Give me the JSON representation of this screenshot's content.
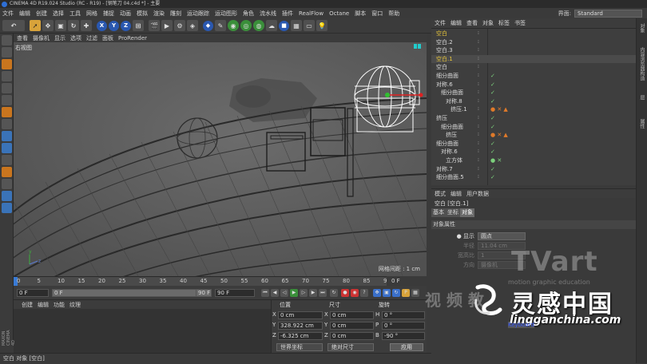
{
  "window": {
    "title": "CINEMA 4D R19.024 Studio (RC - R19) - [钢笔刀 04.c4d *] - 主要"
  },
  "menu": [
    "文件",
    "编辑",
    "创建",
    "选择",
    "工具",
    "网格",
    "捕捉",
    "动画",
    "模拟",
    "渲染",
    "雕刻",
    "运动跟踪",
    "运动图形",
    "角色",
    "流水线",
    "插件",
    "RealFlow",
    "Octane",
    "脚本",
    "窗口",
    "帮助"
  ],
  "layout": {
    "label": "界面:",
    "value": "Standard"
  },
  "toolbar": {
    "undo": "↶",
    "axes": [
      "X",
      "Y",
      "Z"
    ]
  },
  "viewport": {
    "menu": [
      "查看",
      "摄像机",
      "显示",
      "选项",
      "过滤",
      "面板",
      "ProRender"
    ],
    "label": "右视图",
    "grid_spacing": "网格间距 : 1 cm"
  },
  "timeline": {
    "ticks": [
      "0",
      "5",
      "10",
      "15",
      "20",
      "25",
      "30",
      "35",
      "40",
      "45",
      "50",
      "55",
      "60",
      "65",
      "70",
      "75",
      "80",
      "85",
      "90"
    ],
    "frame_display": "0 F",
    "start_field": "0 F",
    "min_field": "0 F",
    "end_min": "90 F",
    "end_max": "90 F"
  },
  "materials": {
    "menu": [
      "创建",
      "编辑",
      "功能",
      "纹理"
    ],
    "logo": "MAXON CINEMA 4D"
  },
  "coordinates": {
    "headers": {
      "position": "位置",
      "size": "尺寸",
      "rotation": "旋转"
    },
    "position": [
      {
        "axis": "X",
        "value": "0 cm"
      },
      {
        "axis": "Y",
        "value": "328.922 cm"
      },
      {
        "axis": "Z",
        "value": "-6.325 cm"
      }
    ],
    "size": [
      {
        "axis": "X",
        "value": "0 cm"
      },
      {
        "axis": "Y",
        "value": "0 cm"
      },
      {
        "axis": "Z",
        "value": "0 cm"
      }
    ],
    "rotation": [
      {
        "axis": "H",
        "value": "0 °"
      },
      {
        "axis": "P",
        "value": "0 °"
      },
      {
        "axis": "B",
        "value": "-90 °"
      }
    ],
    "world_coords": "世界坐标",
    "abs_size": "绝对尺寸",
    "apply": "应用"
  },
  "status": {
    "text": "空白 对象 [空白]"
  },
  "object_manager": {
    "menu": [
      "文件",
      "编辑",
      "查看",
      "对象",
      "标签",
      "书签"
    ],
    "rows": [
      {
        "name": "空白",
        "indent": 0,
        "highlight": true,
        "tags": ""
      },
      {
        "name": "空白.2",
        "indent": 0,
        "highlight": false,
        "tags": ""
      },
      {
        "name": "空白.3",
        "indent": 0,
        "highlight": false,
        "tags": ""
      },
      {
        "name": "空白.1",
        "indent": 0,
        "highlight": true,
        "tags": ""
      },
      {
        "name": "空白",
        "indent": 0,
        "highlight": false,
        "tags": ""
      },
      {
        "name": "细分曲面",
        "indent": 0,
        "highlight": false,
        "tags": "✓"
      },
      {
        "name": "对称.6",
        "indent": 0,
        "highlight": false,
        "tags": "✓"
      },
      {
        "name": "细分曲面",
        "indent": 1,
        "highlight": false,
        "tags": "✓"
      },
      {
        "name": "对称.8",
        "indent": 2,
        "highlight": false,
        "tags": "✓"
      },
      {
        "name": "挤压.1",
        "indent": 3,
        "highlight": false,
        "tags": "● ✕ ▲"
      },
      {
        "name": "挤压",
        "indent": 0,
        "highlight": false,
        "tags": "✓"
      },
      {
        "name": "细分曲面",
        "indent": 1,
        "highlight": false,
        "tags": "✓"
      },
      {
        "name": "挤压",
        "indent": 2,
        "highlight": false,
        "tags": "● ✕ ▲"
      },
      {
        "name": "细分曲面",
        "indent": 0,
        "highlight": false,
        "tags": "✓"
      },
      {
        "name": "对称.6",
        "indent": 1,
        "highlight": false,
        "tags": "✓"
      },
      {
        "name": "立方体",
        "indent": 2,
        "highlight": false,
        "tags": "● ✕"
      },
      {
        "name": "对称.7",
        "indent": 0,
        "highlight": false,
        "tags": "✓"
      },
      {
        "name": "细分曲面.5",
        "indent": 0,
        "highlight": false,
        "tags": "✓"
      }
    ]
  },
  "attributes": {
    "menu": [
      "模式",
      "编辑",
      "用户数据"
    ],
    "title": "空白 [空白.1]",
    "tabs": [
      "基本",
      "坐标",
      "对象"
    ],
    "section": "对象属性",
    "props": [
      {
        "label": "● 显示",
        "value": "圆点",
        "disabled": false
      },
      {
        "label": "半径",
        "value": "11.04 cm",
        "disabled": true
      },
      {
        "label": "宽高比",
        "value": "1",
        "disabled": true
      },
      {
        "label": "方向",
        "value": "摄像机",
        "disabled": true
      }
    ]
  },
  "right_tabs": [
    "对象",
    "内容浏览器",
    "构造",
    "层",
    "属性"
  ],
  "watermark": {
    "tvart": "TVart",
    "tagline": "motion graphic education",
    "cn_text": "视 频 教",
    "brand": "灵感中国",
    "url": "lingganchina.com",
    "kb": "Keyboard"
  }
}
